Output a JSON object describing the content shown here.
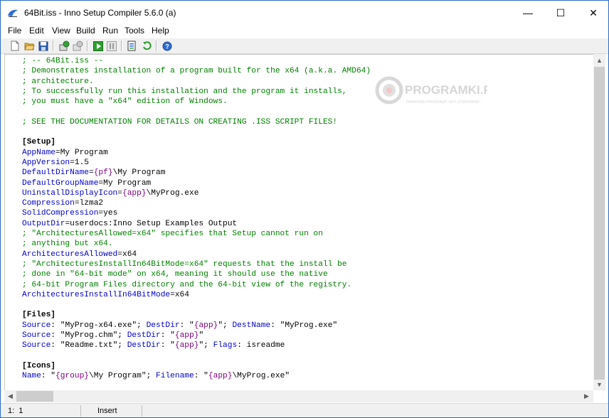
{
  "window": {
    "title": "64Bit.iss - Inno Setup Compiler 5.6.0 (a)",
    "controls": {
      "minimize": "—",
      "maximize": "☐",
      "close": "✕"
    }
  },
  "menu": {
    "file": "File",
    "edit": "Edit",
    "view": "View",
    "build": "Build",
    "run": "Run",
    "tools": "Tools",
    "help": "Help"
  },
  "toolbar": {
    "icons": [
      "new-file-icon",
      "open-folder-icon",
      "save-icon",
      "compile-icon",
      "stop-compile-icon",
      "run-icon",
      "pause-icon",
      "target-icon",
      "refresh-icon",
      "help-icon"
    ]
  },
  "editor": {
    "lines": [
      [
        {
          "t": "cmt",
          "v": "; -- 64Bit.iss --"
        }
      ],
      [
        {
          "t": "cmt",
          "v": "; Demonstrates installation of a program built for the x64 (a.k.a. AMD64)"
        }
      ],
      [
        {
          "t": "cmt",
          "v": "; architecture."
        }
      ],
      [
        {
          "t": "cmt",
          "v": "; To successfully run this installation and the program it installs,"
        }
      ],
      [
        {
          "t": "cmt",
          "v": "; you must have a \"x64\" edition of Windows."
        }
      ],
      [],
      [
        {
          "t": "cmt",
          "v": "; SEE THE DOCUMENTATION FOR DETAILS ON CREATING .ISS SCRIPT FILES!"
        }
      ],
      [],
      [
        {
          "t": "sec",
          "v": "[Setup]"
        }
      ],
      [
        {
          "t": "key",
          "v": "AppName"
        },
        {
          "t": "txt",
          "v": "=My Program"
        }
      ],
      [
        {
          "t": "key",
          "v": "AppVersion"
        },
        {
          "t": "txt",
          "v": "=1.5"
        }
      ],
      [
        {
          "t": "key",
          "v": "DefaultDirName"
        },
        {
          "t": "txt",
          "v": "="
        },
        {
          "t": "con",
          "v": "{pf}"
        },
        {
          "t": "txt",
          "v": "\\My Program"
        }
      ],
      [
        {
          "t": "key",
          "v": "DefaultGroupName"
        },
        {
          "t": "txt",
          "v": "=My Program"
        }
      ],
      [
        {
          "t": "key",
          "v": "UninstallDisplayIcon"
        },
        {
          "t": "txt",
          "v": "="
        },
        {
          "t": "con",
          "v": "{app}"
        },
        {
          "t": "txt",
          "v": "\\MyProg.exe"
        }
      ],
      [
        {
          "t": "key",
          "v": "Compression"
        },
        {
          "t": "txt",
          "v": "=lzma2"
        }
      ],
      [
        {
          "t": "key",
          "v": "SolidCompression"
        },
        {
          "t": "txt",
          "v": "=yes"
        }
      ],
      [
        {
          "t": "key",
          "v": "OutputDir"
        },
        {
          "t": "txt",
          "v": "=userdocs:Inno Setup Examples Output"
        }
      ],
      [
        {
          "t": "cmt",
          "v": "; \"ArchitecturesAllowed=x64\" specifies that Setup cannot run on"
        }
      ],
      [
        {
          "t": "cmt",
          "v": "; anything but x64."
        }
      ],
      [
        {
          "t": "key",
          "v": "ArchitecturesAllowed"
        },
        {
          "t": "txt",
          "v": "=x64"
        }
      ],
      [
        {
          "t": "cmt",
          "v": "; \"ArchitecturesInstallIn64BitMode=x64\" requests that the install be"
        }
      ],
      [
        {
          "t": "cmt",
          "v": "; done in \"64-bit mode\" on x64, meaning it should use the native"
        }
      ],
      [
        {
          "t": "cmt",
          "v": "; 64-bit Program Files directory and the 64-bit view of the registry."
        }
      ],
      [
        {
          "t": "key",
          "v": "ArchitecturesInstallIn64BitMode"
        },
        {
          "t": "txt",
          "v": "=x64"
        }
      ],
      [],
      [
        {
          "t": "sec",
          "v": "[Files]"
        }
      ],
      [
        {
          "t": "key",
          "v": "Source"
        },
        {
          "t": "txt",
          "v": ": \"MyProg-x64.exe\"; "
        },
        {
          "t": "key",
          "v": "DestDir"
        },
        {
          "t": "txt",
          "v": ": \""
        },
        {
          "t": "con",
          "v": "{app}"
        },
        {
          "t": "txt",
          "v": "\"; "
        },
        {
          "t": "key",
          "v": "DestName"
        },
        {
          "t": "txt",
          "v": ": \"MyProg.exe\""
        }
      ],
      [
        {
          "t": "key",
          "v": "Source"
        },
        {
          "t": "txt",
          "v": ": \"MyProg.chm\"; "
        },
        {
          "t": "key",
          "v": "DestDir"
        },
        {
          "t": "txt",
          "v": ": \""
        },
        {
          "t": "con",
          "v": "{app}"
        },
        {
          "t": "txt",
          "v": "\""
        }
      ],
      [
        {
          "t": "key",
          "v": "Source"
        },
        {
          "t": "txt",
          "v": ": \"Readme.txt\"; "
        },
        {
          "t": "key",
          "v": "DestDir"
        },
        {
          "t": "txt",
          "v": ": \""
        },
        {
          "t": "con",
          "v": "{app}"
        },
        {
          "t": "txt",
          "v": "\"; "
        },
        {
          "t": "key",
          "v": "Flags"
        },
        {
          "t": "txt",
          "v": ": isreadme"
        }
      ],
      [],
      [
        {
          "t": "sec",
          "v": "[Icons]"
        }
      ],
      [
        {
          "t": "key",
          "v": "Name"
        },
        {
          "t": "txt",
          "v": ": \""
        },
        {
          "t": "con",
          "v": "{group}"
        },
        {
          "t": "txt",
          "v": "\\My Program\"; "
        },
        {
          "t": "key",
          "v": "Filename"
        },
        {
          "t": "txt",
          "v": ": \""
        },
        {
          "t": "con",
          "v": "{app}"
        },
        {
          "t": "txt",
          "v": "\\MyProg.exe\""
        }
      ]
    ]
  },
  "watermark": {
    "brand": "PROGRAMKI.PL",
    "tagline": "DARMOWE PROGRAMY, GRY, STEROWNIKI"
  },
  "scrollbars": {
    "up": "▲",
    "down": "▼",
    "left": "◀",
    "right": "▶"
  },
  "status": {
    "line": "1",
    "column": "1",
    "mode": "Insert"
  },
  "colors": {
    "comment": "#008000",
    "keyword": "#0000cc",
    "constant": "#800080",
    "window_border": "#2b6cc4"
  }
}
